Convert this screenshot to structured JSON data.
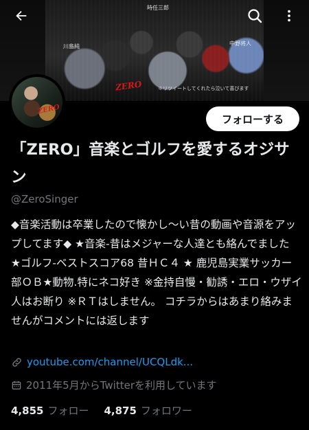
{
  "banner": {
    "caption_top": "時任三郎",
    "caption_left": "川島純",
    "caption_right": "中野将人",
    "caption_bottom": "※リツイートしてくれたら泣いて喜びます",
    "logo_text": "ZERO"
  },
  "avatar": {
    "logo_text": "ZERO"
  },
  "header": {
    "back_icon": "arrow-left-icon",
    "search_icon": "search-icon",
    "more_icon": "more-vertical-icon"
  },
  "profile": {
    "follow_label": "フォローする",
    "display_name": "「ZERO」音楽とゴルフを愛するオジサン",
    "handle": "@ZeroSinger",
    "bio": "◆音楽活動は卒業したので懐かし〜い昔の動画や音源をアップしてます◆ ★音楽-昔はメジャーな人達とも絡んでました ★ゴルフ-ベストスコア68 昔ＨＣ４ ★ 鹿児島実業サッカー部ＯＢ★動物.特にネコ好き ※金持自慢・勧誘・エロ・ウザイ人はお断り ※ＲＴはしません。 コチラからはあまり絡みませんがコメントには返します",
    "link": "youtube.com/channel/UCQLdk...",
    "joined": "2011年5月からTwitterを利用しています",
    "following_count": "4,855",
    "following_label": "フォロー",
    "followers_count": "4,875",
    "followers_label": "フォロワー"
  },
  "colors": {
    "background": "#000000",
    "text": "#e7e9ea",
    "secondary": "#71767b",
    "link": "#1d9bf0"
  }
}
